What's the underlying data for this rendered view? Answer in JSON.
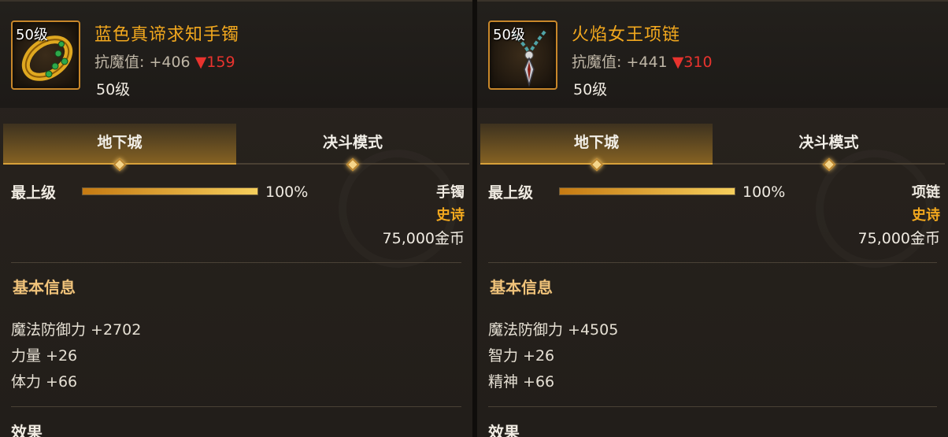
{
  "panels": [
    {
      "item_name": "蓝色真谛求知手镯",
      "level_tag": "50级",
      "resist_label": "抗魔值:",
      "resist_value": "+406",
      "resist_diff": "▼159",
      "level_text": "50级",
      "tabs": [
        "地下城",
        "决斗模式"
      ],
      "rank_label": "最上级",
      "rank_percent_text": "100%",
      "rank_fill": 1.0,
      "slot": "手镯",
      "rarity": "史诗",
      "price": "75,000金币",
      "basic_info_title": "基本信息",
      "attributes": [
        "魔法防御力 +2702",
        "力量 +26",
        "体力 +66"
      ],
      "effect_title": "效果",
      "icon": "golden-bracelet-icon"
    },
    {
      "item_name": "火焰女王项链",
      "level_tag": "50级",
      "resist_label": "抗魔值:",
      "resist_value": "+441",
      "resist_diff": "▼310",
      "level_text": "50级",
      "tabs": [
        "地下城",
        "决斗模式"
      ],
      "rank_label": "最上级",
      "rank_percent_text": "100%",
      "rank_fill": 1.0,
      "slot": "项链",
      "rarity": "史诗",
      "price": "75,000金币",
      "basic_info_title": "基本信息",
      "attributes": [
        "魔法防御力 +4505",
        "智力 +26",
        "精神 +66"
      ],
      "effect_title": "效果",
      "icon": "chain-necklace-icon"
    }
  ],
  "colors": {
    "item_name": "#f2a81e",
    "diff_down": "#e8332e",
    "rarity_epic": "#f2a81e",
    "section_title": "#f0c37a",
    "accent_border": "#c8872a"
  }
}
